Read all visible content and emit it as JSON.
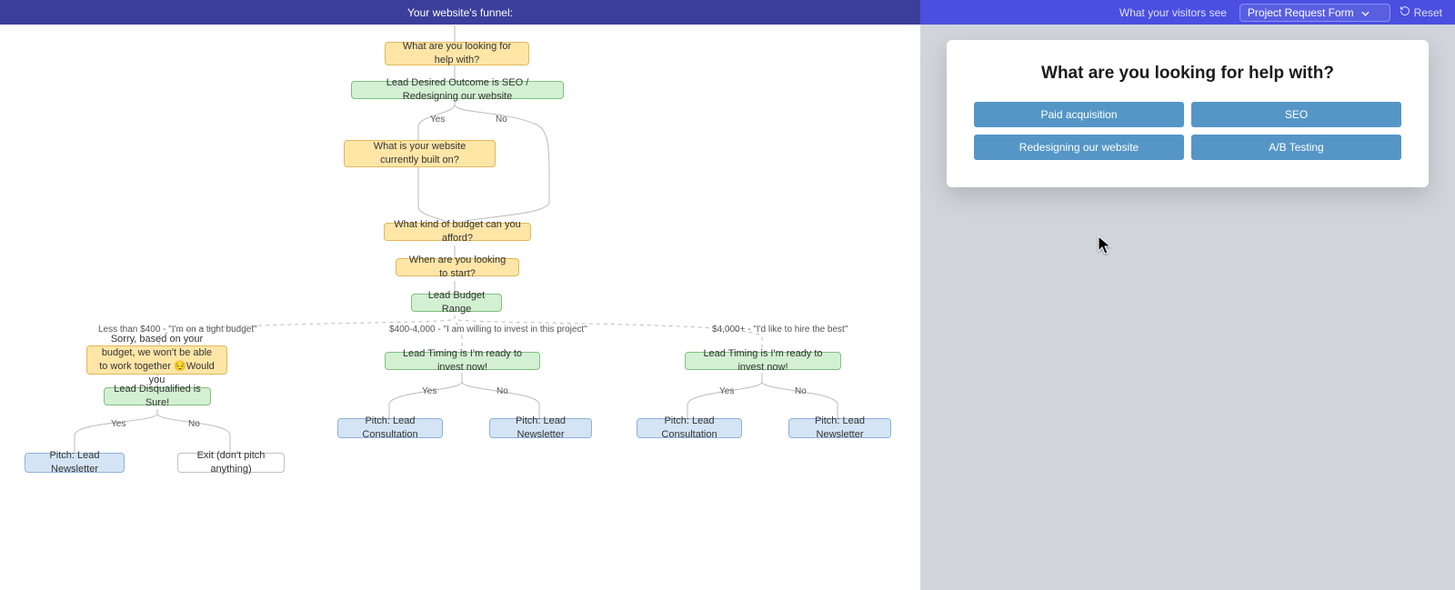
{
  "left": {
    "header_title": "Your website's funnel:",
    "nodes": {
      "q_help": "What are you looking for help with?",
      "lead_outcome": "Lead Desired Outcome is SEO / Redesigning our website",
      "q_built": "What is your website currently built on?",
      "q_budget": "What kind of budget can you afford?",
      "q_start": "When are you looking to start?",
      "lead_budget": "Lead Budget Range",
      "sorry": "Sorry, based on your budget, we won't be able to work together 😔Would you",
      "lead_disq": "Lead Disqualified is Sure!",
      "lead_timing_m": "Lead Timing is I'm ready to invest now!",
      "lead_timing_r": "Lead Timing is I'm ready to invest now!",
      "pitch_news_l": "Pitch: Lead Newsletter",
      "exit": "Exit (don't pitch anything)",
      "pitch_cons_m": "Pitch: Lead Consultation",
      "pitch_news_m": "Pitch: Lead Newsletter",
      "pitch_cons_r": "Pitch: Lead Consultation",
      "pitch_news_r": "Pitch: Lead Newsletter"
    },
    "edge_labels": {
      "yes1": "Yes",
      "no1": "No",
      "lt400": "Less than $400 - \"I'm on a tight budget\"",
      "mid": "$400-4,000 - \"I am willing to invest in this project\"",
      "gt4k": "$4,000+ - \"I'd like to hire the best\"",
      "lyesA": "Yes",
      "lnoA": "No",
      "lyesB": "Yes",
      "lnoB": "No",
      "lyesC": "Yes",
      "lnoC": "No"
    }
  },
  "right": {
    "header_label": "What your visitors see",
    "select_value": "Project Request Form",
    "reset_label": "Reset",
    "preview": {
      "title": "What are you looking for help with?",
      "options": [
        "Paid acquisition",
        "SEO",
        "Redesigning our website",
        "A/B Testing"
      ]
    }
  }
}
